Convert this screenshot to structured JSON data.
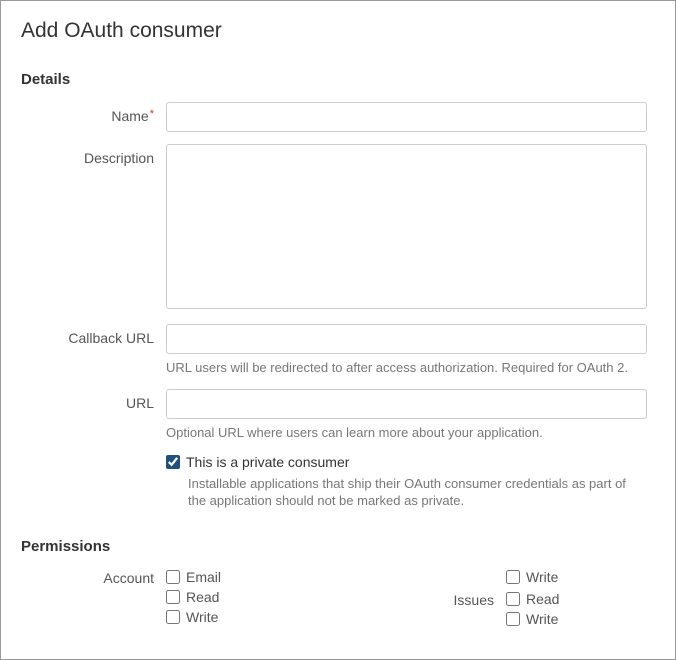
{
  "page_title": "Add OAuth consumer",
  "sections": {
    "details": {
      "heading": "Details",
      "name": {
        "label": "Name",
        "required": true,
        "value": ""
      },
      "description": {
        "label": "Description",
        "value": ""
      },
      "callback_url": {
        "label": "Callback URL",
        "value": "",
        "help": "URL users will be redirected to after access authorization. Required for OAuth 2."
      },
      "url": {
        "label": "URL",
        "value": "",
        "help": "Optional URL where users can learn more about your application."
      },
      "private_consumer": {
        "checked": true,
        "label": "This is a private consumer",
        "help": "Installable applications that ship their OAuth consumer credentials as part of the application should not be marked as private."
      }
    },
    "permissions": {
      "heading": "Permissions",
      "account": {
        "label": "Account",
        "options": {
          "email": {
            "label": "Email",
            "checked": false
          },
          "read": {
            "label": "Read",
            "checked": false
          },
          "write": {
            "label": "Write",
            "checked": false
          }
        }
      },
      "extra_write": {
        "label": "Write",
        "checked": false
      },
      "issues": {
        "label": "Issues",
        "options": {
          "read": {
            "label": "Read",
            "checked": false
          },
          "write": {
            "label": "Write",
            "checked": false
          }
        }
      }
    }
  }
}
